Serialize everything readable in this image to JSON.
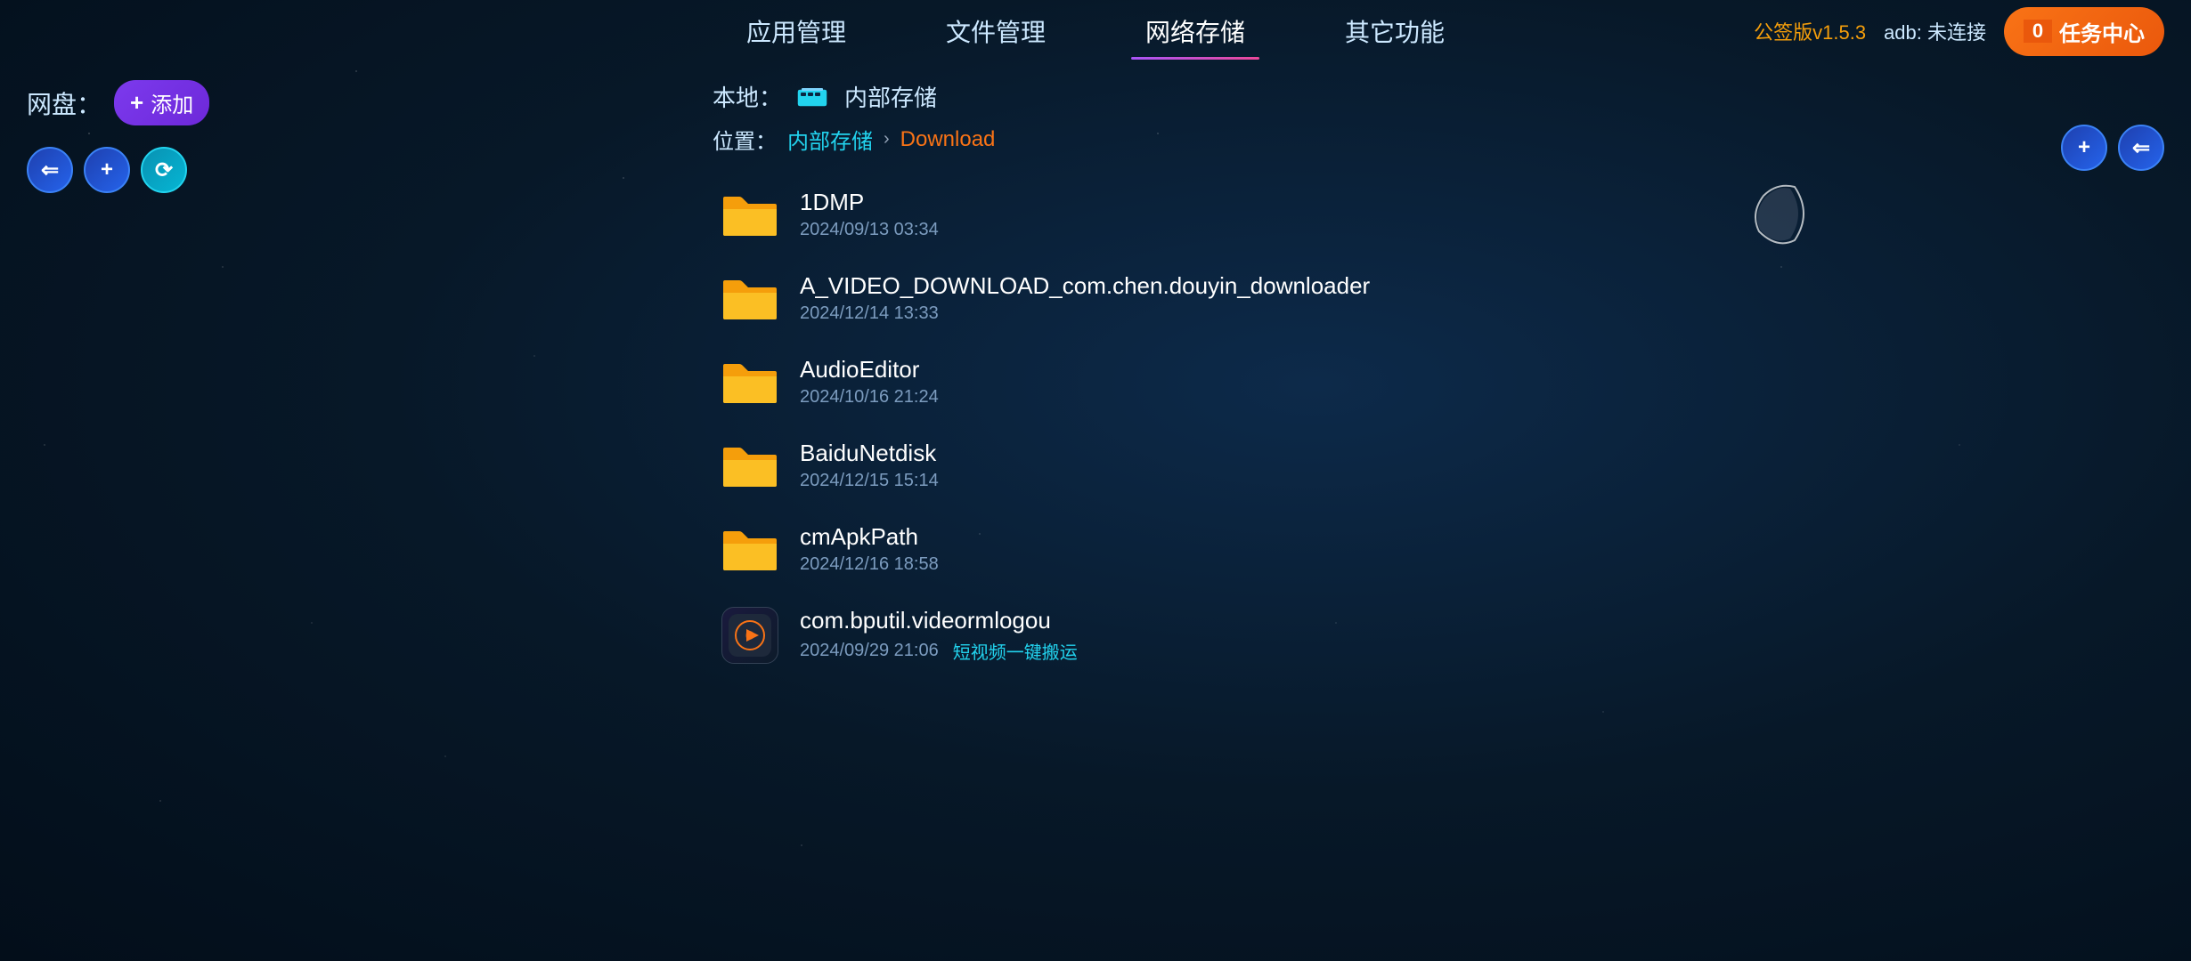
{
  "nav": {
    "items": [
      {
        "id": "app-manage",
        "label": "应用管理",
        "active": false
      },
      {
        "id": "file-manage",
        "label": "文件管理",
        "active": false
      },
      {
        "id": "network-storage",
        "label": "网络存储",
        "active": true
      },
      {
        "id": "other-features",
        "label": "其它功能",
        "active": false
      }
    ],
    "version": "公签版v1.5.3",
    "adb_status": "adb: 未连接",
    "task_center": "任务中心",
    "task_count": "0"
  },
  "left": {
    "netdisk_label": "网盘：",
    "add_label": "添加",
    "btn_back": "⇐",
    "btn_plus": "+",
    "btn_refresh": "⟳"
  },
  "main": {
    "local_label": "本地：",
    "storage_name": "内部存储",
    "breadcrumb_label": "位置：",
    "breadcrumb_root": "内部存储",
    "breadcrumb_separator": "›",
    "breadcrumb_current": "Download",
    "files": [
      {
        "id": "1dmp",
        "type": "folder",
        "name": "1DMP",
        "date": "2024/09/13 03:34",
        "tag": ""
      },
      {
        "id": "a-video-download",
        "type": "folder",
        "name": "A_VIDEO_DOWNLOAD_com.chen.douyin_downloader",
        "date": "2024/12/14 13:33",
        "tag": ""
      },
      {
        "id": "audio-editor",
        "type": "folder",
        "name": "AudioEditor",
        "date": "2024/10/16 21:24",
        "tag": ""
      },
      {
        "id": "baidu-netdisk",
        "type": "folder",
        "name": "BaiduNetdisk",
        "date": "2024/12/15 15:14",
        "tag": ""
      },
      {
        "id": "cm-apk-path",
        "type": "folder",
        "name": "cmApkPath",
        "date": "2024/12/16 18:58",
        "tag": ""
      },
      {
        "id": "com-bputil-video",
        "type": "app",
        "name": "com.bputil.videormlogou",
        "date": "2024/09/29 21:06",
        "tag": "短视频一键搬运"
      }
    ]
  },
  "right": {
    "btn_plus": "+",
    "btn_back": "⇐"
  }
}
